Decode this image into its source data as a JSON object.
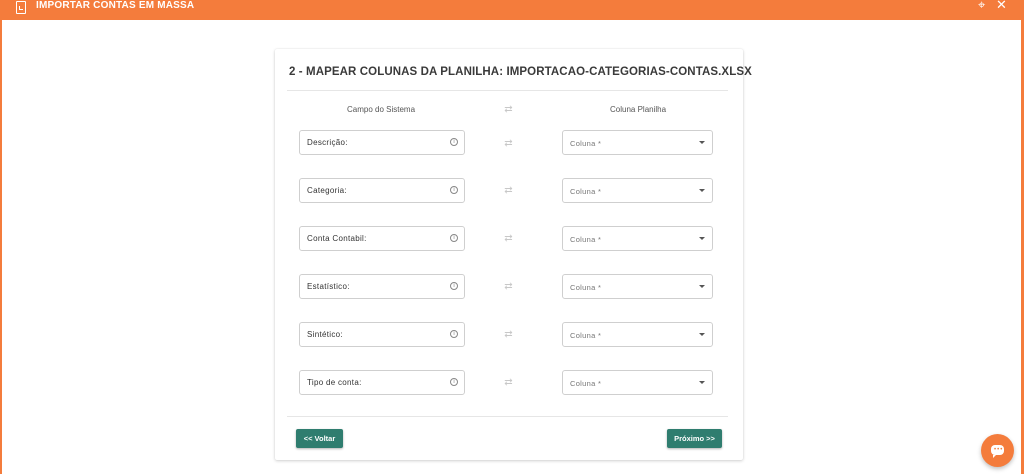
{
  "window": {
    "title": "IMPORTAR CONTAS EM MASSA",
    "pin_icon": "pin-icon",
    "close_icon": "close-icon"
  },
  "card": {
    "title": "2 - MAPEAR COLUNAS DA PLANILHA: IMPORTACAO-CATEGORIAS-CONTAS.XLSX",
    "col_system": "Campo do Sistema",
    "col_sheet": "Coluna Planilha",
    "rows": [
      {
        "field": "Descrição:",
        "select_placeholder": "Coluna *"
      },
      {
        "field": "Categoria:",
        "select_placeholder": "Coluna *"
      },
      {
        "field": "Conta Contabil:",
        "select_placeholder": "Coluna *"
      },
      {
        "field": "Estatístico:",
        "select_placeholder": "Coluna *"
      },
      {
        "field": "Sintético:",
        "select_placeholder": "Coluna *"
      },
      {
        "field": "Tipo de conta:",
        "select_placeholder": "Coluna *"
      }
    ],
    "back_label": "<< Voltar",
    "next_label": "Próximo >>"
  },
  "colors": {
    "accent": "#f47c3c",
    "button": "#2f7d6f"
  }
}
